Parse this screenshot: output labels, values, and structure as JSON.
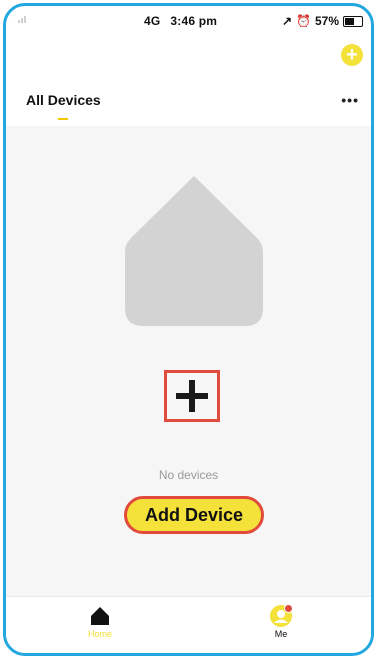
{
  "status_bar": {
    "network": "4G",
    "time": "3:46 pm",
    "battery": "57%"
  },
  "header": {
    "add_icon": "plus-circle",
    "tab_label": "All Devices",
    "more_icon": "ellipsis"
  },
  "empty_state": {
    "message": "No devices",
    "button_label": "Add Device"
  },
  "bottom_nav": {
    "home_label": "Home",
    "me_label": "Me"
  },
  "colors": {
    "accent": "#f4e13a",
    "highlight": "#e04b3b",
    "frame": "#23a7e0"
  }
}
